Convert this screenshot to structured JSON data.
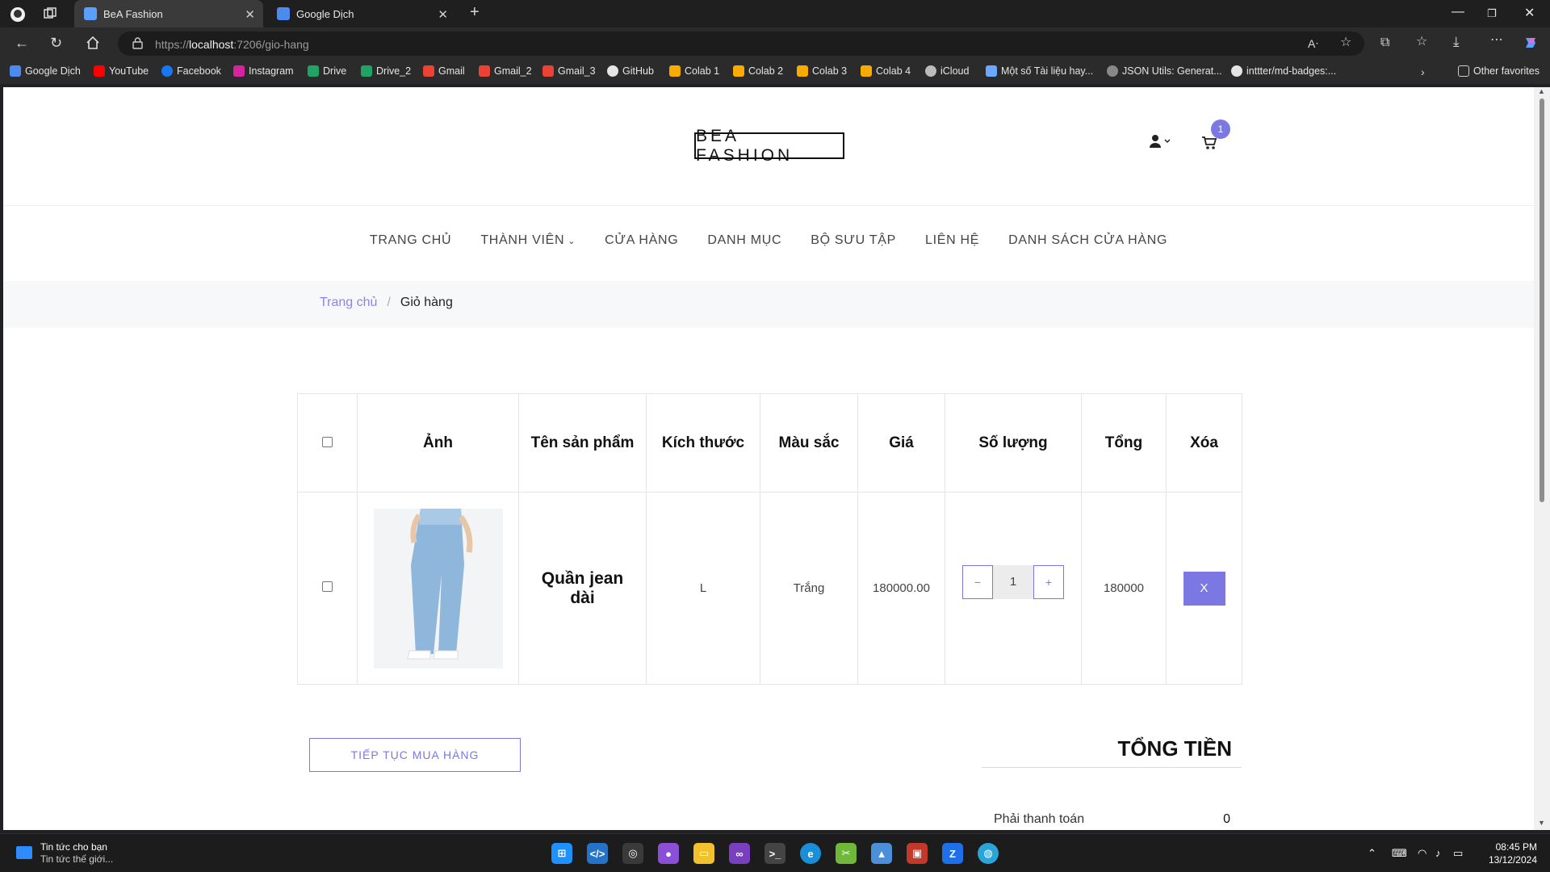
{
  "browser": {
    "tabs": [
      {
        "title": "BeA Fashion",
        "active": true
      },
      {
        "title": "Google Dịch",
        "active": false
      }
    ],
    "url_prefix": "https://",
    "url_host": "localhost",
    "url_rest": ":7206/gio-hang",
    "bookmarks": [
      "Google Dịch",
      "YouTube",
      "Facebook",
      "Instagram",
      "Drive",
      "Drive_2",
      "Gmail",
      "Gmail_2",
      "Gmail_3",
      "GitHub",
      "Colab 1",
      "Colab 2",
      "Colab 3",
      "Colab 4",
      "iCloud",
      "Một số Tài liệu hay...",
      "JSON Utils: Generat...",
      "inttter/md-badges:..."
    ],
    "other_favorites": "Other favorites"
  },
  "site": {
    "logo": "BEA FASHION",
    "cart_count": "1",
    "nav": [
      "TRANG CHỦ",
      "THÀNH VIÊN",
      "CỬA HÀNG",
      "DANH MỤC",
      "BỘ SƯU TẬP",
      "LIÊN HỆ",
      "DANH SÁCH CỬA HÀNG"
    ],
    "breadcrumb": {
      "home": "Trang chủ",
      "separator": "/",
      "current": "Giỏ hàng"
    }
  },
  "cart": {
    "headers": [
      "Ảnh",
      "Tên sản phẩm",
      "Kích thước",
      "Màu sắc",
      "Giá",
      "Số lượng",
      "Tổng",
      "Xóa"
    ],
    "items": [
      {
        "name": "Quần jean dài",
        "size": "L",
        "color": "Trắng",
        "price": "180000.00",
        "quantity": "1",
        "total": "180000",
        "remove": "X"
      }
    ],
    "qty_minus": "−",
    "qty_plus": "+",
    "continue_label": "TIẾP TỤC MUA HÀNG",
    "total_title": "TỔNG TIỀN",
    "pay_label": "Phải thanh toán",
    "pay_value": "0"
  },
  "taskbar": {
    "news_title": "Tin tức cho bạn",
    "news_sub": "Tin tức thế giới...",
    "time": "08:45 PM",
    "date": "13/12/2024"
  },
  "colors": {
    "accent": "#7b78e4",
    "chrome": "#2b2b2b"
  }
}
